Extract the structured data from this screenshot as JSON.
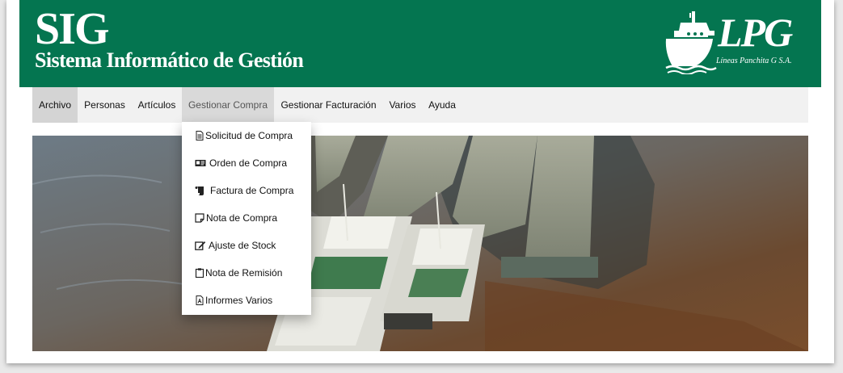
{
  "header": {
    "app_abbrev": "SIG",
    "app_title": "Sistema Informático de Gestión",
    "logo_text": "LPG",
    "logo_subtitle": "Líneas Panchita G S.A.",
    "bg_color": "#047550"
  },
  "menu": {
    "items": [
      {
        "label": "Archivo",
        "state": "active"
      },
      {
        "label": "Personas"
      },
      {
        "label": "Artículos"
      },
      {
        "label": "Gestionar Compra",
        "state": "hover"
      },
      {
        "label": "Gestionar Facturación"
      },
      {
        "label": "Varios"
      },
      {
        "label": "Ayuda"
      }
    ]
  },
  "dropdown": {
    "parent": "Gestionar Compra",
    "items": [
      {
        "label": "Solicitud de Compra",
        "icon": "document-icon"
      },
      {
        "label": "Orden de Compra",
        "icon": "id-card-icon"
      },
      {
        "label": "Factura de Compra",
        "icon": "scroll-icon"
      },
      {
        "label": "Nota de Compra",
        "icon": "sticky-note-icon"
      },
      {
        "label": "Ajuste de Stock",
        "icon": "edit-icon"
      },
      {
        "label": "Nota de Remisión",
        "icon": "clipboard-icon"
      },
      {
        "label": "Informes Varios",
        "icon": "pdf-file-icon"
      }
    ]
  },
  "hero": {
    "subject": "river barges convoy image"
  }
}
